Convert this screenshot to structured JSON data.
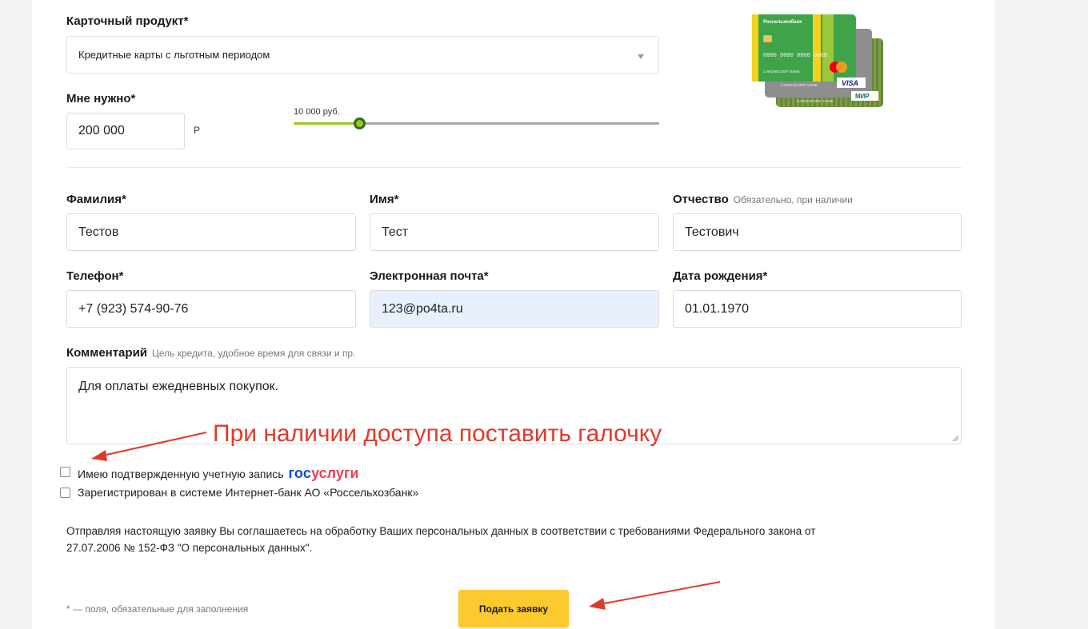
{
  "card_product": {
    "label": "Карточный продукт*",
    "selected": "Кредитные карты с льготным периодом"
  },
  "amount": {
    "label": "Мне нужно*",
    "value": "200 000",
    "currency": "Р",
    "slider_label": "10 000 руб.",
    "slider_level": 0.18
  },
  "fields": {
    "last_name": {
      "label": "Фамилия*",
      "value": "Тестов"
    },
    "first_name": {
      "label": "Имя*",
      "value": "Тест"
    },
    "patronymic": {
      "label": "Отчество",
      "hint": "Обязательно, при наличии",
      "value": "Тестович"
    },
    "phone": {
      "label": "Телефон*",
      "value": "+7 (923) 574-90-76"
    },
    "email": {
      "label": "Электронная почта*",
      "value": "123@po4ta.ru"
    },
    "birth_date": {
      "label": "Дата рождения*",
      "value": "01.01.1970"
    },
    "comment": {
      "label": "Комментарий",
      "hint": "Цель кредита, удобное время для связи и пр.",
      "value": "Для оплаты ежедневных покупок."
    }
  },
  "checkboxes": {
    "gosuslugi": {
      "label": "Имею подтвержденную учетную запись",
      "logo_part1": "гос",
      "logo_part2": "услуги",
      "checked": false
    },
    "internet_bank": {
      "label": "Зарегистрирован в системе Интернет-банк АО «Россельхозбанк»",
      "checked": false
    }
  },
  "annotation": "При наличии доступа поставить галочку",
  "consent_text_line1": "Отправляя настоящую заявку Вы соглашаетесь на обработку Ваших персональных данных в соответствии с требованиями Федерального закона от",
  "consent_text_line2": "27.07.2006 № 152-ФЗ \"О персональных данных\".",
  "required_note": "* — поля, обязательные для заполнения",
  "submit_label": "Подать заявку",
  "cards_image": {
    "bank_name": "Россельхозбанк",
    "card_number": "0000 0000 0000 0000",
    "holder": "CARDHOLDER NAME",
    "brands": [
      "mastercard",
      "VISA",
      "МИР"
    ]
  },
  "colors": {
    "accent_yellow": "#fcc92f",
    "slider_green": "#9bc81e",
    "annotation_red": "#e03a2a",
    "gosu_blue": "#0d4cd3",
    "gosu_red": "#ee3f58"
  }
}
